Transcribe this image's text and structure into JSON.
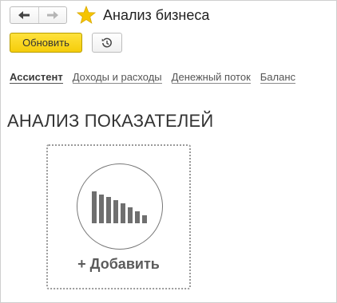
{
  "header": {
    "title": "Анализ бизнеса",
    "back_icon": "arrow-left-icon",
    "forward_icon": "arrow-right-icon",
    "favorite_icon": "star-icon",
    "favorite_color": "#f5c400"
  },
  "toolbar": {
    "refresh_label": "Обновить",
    "refresh_color": "#f5cd0a",
    "history_icon": "history-icon"
  },
  "tabs": [
    {
      "label": "Ассистент",
      "active": true
    },
    {
      "label": "Доходы и расходы",
      "active": false
    },
    {
      "label": "Денежный поток",
      "active": false
    },
    {
      "label": "Баланс",
      "active": false
    }
  ],
  "section": {
    "title": "АНАЛИЗ ПОКАЗАТЕЛЕЙ",
    "add_label": "+ Добавить",
    "add_icon": "bar-chart-icon"
  }
}
